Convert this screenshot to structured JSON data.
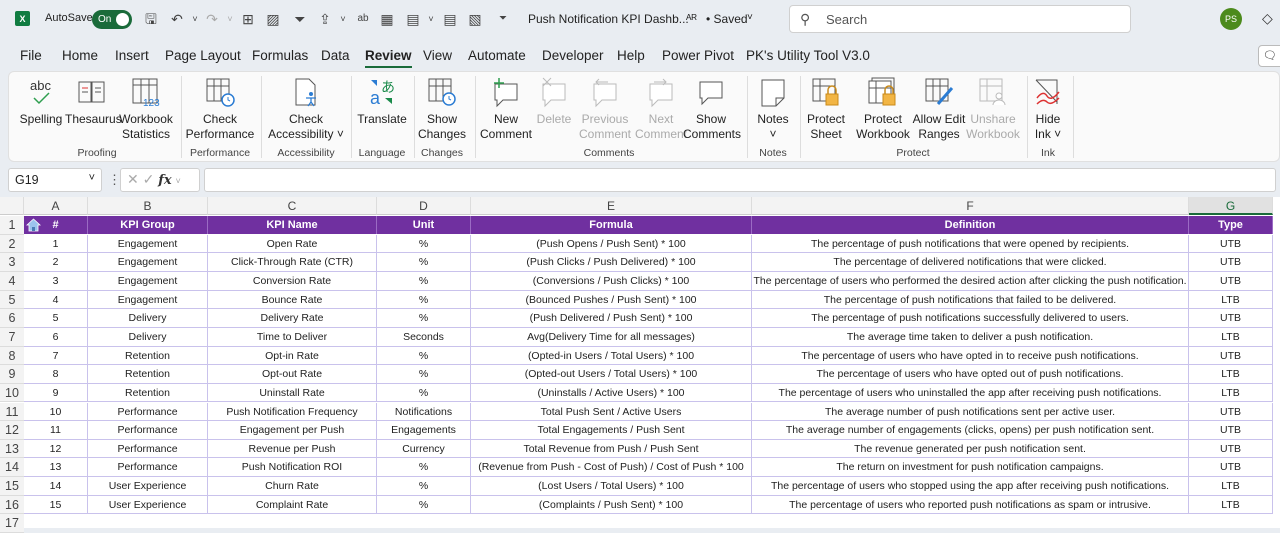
{
  "titlebar": {
    "app_icon": "excel-logo-icon",
    "autosave_label": "AutoSave",
    "autosave_state": "On",
    "doc_title": "Push Notification KPI Dashb...",
    "saved_status": "• Saved",
    "search_placeholder": "Search",
    "user_initials": "PS",
    "quick_access_icons": [
      "save-icon",
      "undo-icon",
      "redo-icon",
      "borders-icon",
      "form-icon",
      "filter-icon",
      "share-icon",
      "spelling-icon",
      "table-icon",
      "calculator-icon",
      "calculator-icon-2",
      "form-icon-2",
      "customize-icon"
    ]
  },
  "tabs": [
    "File",
    "Home",
    "Insert",
    "Page Layout",
    "Formulas",
    "Data",
    "Review",
    "View",
    "Automate",
    "Developer",
    "Help",
    "Power Pivot",
    "PK's Utility Tool V3.0"
  ],
  "active_tab": "Review",
  "ribbon": {
    "groups": [
      {
        "label": "Proofing",
        "buttons": [
          {
            "label1": "Spelling",
            "label2": "",
            "icon": "spelling-icon"
          },
          {
            "label1": "Thesaurus",
            "label2": "",
            "icon": "thesaurus-icon"
          },
          {
            "label1": "Workbook",
            "label2": "Statistics",
            "icon": "workbook-statistics-icon"
          }
        ]
      },
      {
        "label": "Performance",
        "buttons": [
          {
            "label1": "Check",
            "label2": "Performance",
            "icon": "check-performance-icon"
          }
        ]
      },
      {
        "label": "Accessibility",
        "buttons": [
          {
            "label1": "Check",
            "label2": "Accessibility ˅",
            "icon": "check-accessibility-icon"
          }
        ]
      },
      {
        "label": "Language",
        "buttons": [
          {
            "label1": "Translate",
            "label2": "",
            "icon": "translate-icon"
          }
        ]
      },
      {
        "label": "Changes",
        "buttons": [
          {
            "label1": "Show",
            "label2": "Changes",
            "icon": "show-changes-icon"
          }
        ]
      },
      {
        "label": "Comments",
        "buttons": [
          {
            "label1": "New",
            "label2": "Comment",
            "icon": "new-comment-icon"
          },
          {
            "label1": "Delete",
            "label2": "",
            "icon": "delete-comment-icon",
            "disabled": true
          },
          {
            "label1": "Previous",
            "label2": "Comment",
            "icon": "previous-comment-icon",
            "disabled": true
          },
          {
            "label1": "Next",
            "label2": "Comment",
            "icon": "next-comment-icon",
            "disabled": true
          },
          {
            "label1": "Show",
            "label2": "Comments",
            "icon": "show-comments-icon"
          }
        ]
      },
      {
        "label": "Notes",
        "buttons": [
          {
            "label1": "Notes",
            "label2": "˅",
            "icon": "notes-icon"
          }
        ]
      },
      {
        "label": "Protect",
        "buttons": [
          {
            "label1": "Protect",
            "label2": "Sheet",
            "icon": "protect-sheet-icon"
          },
          {
            "label1": "Protect",
            "label2": "Workbook",
            "icon": "protect-workbook-icon"
          },
          {
            "label1": "Allow Edit",
            "label2": "Ranges",
            "icon": "allow-edit-ranges-icon"
          },
          {
            "label1": "Unshare",
            "label2": "Workbook",
            "icon": "unshare-workbook-icon",
            "disabled": true
          }
        ]
      },
      {
        "label": "Ink",
        "buttons": [
          {
            "label1": "Hide",
            "label2": "Ink ˅",
            "icon": "hide-ink-icon"
          }
        ]
      }
    ]
  },
  "formula_bar": {
    "name_box": "G19",
    "formula": ""
  },
  "sheet": {
    "columns": [
      "A",
      "B",
      "C",
      "D",
      "E",
      "F",
      "G"
    ],
    "selected_column": "G",
    "row_numbers": [
      "1",
      "2",
      "3",
      "4",
      "5",
      "6",
      "7",
      "8",
      "9",
      "10",
      "11",
      "12",
      "13",
      "14",
      "15",
      "16",
      "17"
    ],
    "header": [
      "#",
      "KPI Group",
      "KPI Name",
      "Unit",
      "Formula",
      "Definition",
      "Type"
    ],
    "header_bg": "#7030a0",
    "rows": [
      [
        "1",
        "Engagement",
        "Open Rate",
        "%",
        "(Push Opens / Push Sent) * 100",
        "The percentage of push notifications that were opened by recipients.",
        "UTB"
      ],
      [
        "2",
        "Engagement",
        "Click-Through Rate (CTR)",
        "%",
        "(Push Clicks / Push Delivered) * 100",
        "The percentage of delivered notifications that were clicked.",
        "UTB"
      ],
      [
        "3",
        "Engagement",
        "Conversion Rate",
        "%",
        "(Conversions / Push Clicks) * 100",
        "The percentage of users who performed the desired action after clicking the push notification.",
        "UTB"
      ],
      [
        "4",
        "Engagement",
        "Bounce Rate",
        "%",
        "(Bounced Pushes / Push Sent) * 100",
        "The percentage of push notifications that failed to be delivered.",
        "LTB"
      ],
      [
        "5",
        "Delivery",
        "Delivery Rate",
        "%",
        "(Push Delivered / Push Sent) * 100",
        "The percentage of push notifications successfully delivered to users.",
        "UTB"
      ],
      [
        "6",
        "Delivery",
        "Time to Deliver",
        "Seconds",
        "Avg(Delivery Time for all messages)",
        "The average time taken to deliver a push notification.",
        "LTB"
      ],
      [
        "7",
        "Retention",
        "Opt-in Rate",
        "%",
        "(Opted-in Users / Total Users) * 100",
        "The percentage of users who have opted in to receive push notifications.",
        "UTB"
      ],
      [
        "8",
        "Retention",
        "Opt-out Rate",
        "%",
        "(Opted-out Users / Total Users) * 100",
        "The percentage of users who have opted out of push notifications.",
        "LTB"
      ],
      [
        "9",
        "Retention",
        "Uninstall Rate",
        "%",
        "(Uninstalls / Active Users) * 100",
        "The percentage of users who uninstalled the app after receiving push notifications.",
        "LTB"
      ],
      [
        "10",
        "Performance",
        "Push Notification Frequency",
        "Notifications",
        "Total Push Sent / Active Users",
        "The average number of push notifications sent per active user.",
        "UTB"
      ],
      [
        "11",
        "Performance",
        "Engagement per Push",
        "Engagements",
        "Total Engagements / Push Sent",
        "The average number of engagements (clicks, opens) per push notification sent.",
        "UTB"
      ],
      [
        "12",
        "Performance",
        "Revenue per Push",
        "Currency",
        "Total Revenue from Push / Push Sent",
        "The revenue generated per push notification sent.",
        "UTB"
      ],
      [
        "13",
        "Performance",
        "Push Notification ROI",
        "%",
        "(Revenue from Push - Cost of Push) / Cost of Push * 100",
        "The return on investment for push notification campaigns.",
        "UTB"
      ],
      [
        "14",
        "User Experience",
        "Churn Rate",
        "%",
        "(Lost Users / Total Users) * 100",
        "The percentage of users who stopped using the app after receiving push notifications.",
        "LTB"
      ],
      [
        "15",
        "User Experience",
        "Complaint Rate",
        "%",
        "(Complaints / Push Sent) * 100",
        "The percentage of users who reported push notifications as spam or intrusive.",
        "LTB"
      ]
    ]
  }
}
